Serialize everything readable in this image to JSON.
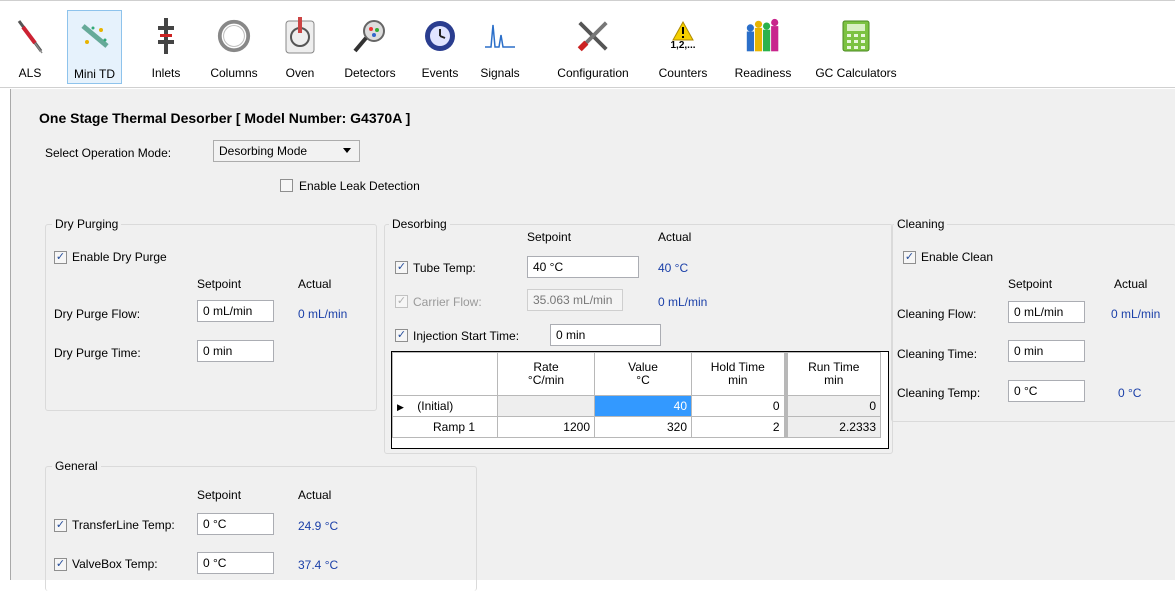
{
  "toolbar": {
    "items": [
      {
        "label": "ALS",
        "icon": "syringe-icon"
      },
      {
        "label": "Mini TD",
        "icon": "mini-td-icon"
      },
      {
        "label": "Inlets",
        "icon": "inlet-icon"
      },
      {
        "label": "Columns",
        "icon": "column-icon"
      },
      {
        "label": "Oven",
        "icon": "oven-icon"
      },
      {
        "label": "Detectors",
        "icon": "detector-icon"
      },
      {
        "label": "Events",
        "icon": "events-icon"
      },
      {
        "label": "Signals",
        "icon": "signal-icon"
      },
      {
        "label": "Configuration",
        "icon": "tools-icon"
      },
      {
        "label": "Counters",
        "icon": "warning-counter-icon",
        "icon_text": "1,2,..."
      },
      {
        "label": "Readiness",
        "icon": "readiness-icon"
      },
      {
        "label": "GC Calculators",
        "icon": "calculator-icon"
      }
    ],
    "active": "Mini TD"
  },
  "page": {
    "title": "One Stage Thermal Desorber [ Model Number: G4370A ]",
    "operation_mode_label": "Select Operation Mode:",
    "operation_mode_value": "Desorbing Mode",
    "leak_detection_label": "Enable Leak Detection",
    "leak_detection_checked": false
  },
  "dry_purging": {
    "title": "Dry Purging",
    "enable_label": "Enable Dry Purge",
    "enable_checked": true,
    "setpoint_header": "Setpoint",
    "actual_header": "Actual",
    "flow_label": "Dry Purge Flow:",
    "flow_setpoint": "0 mL/min",
    "flow_actual": "0 mL/min",
    "time_label": "Dry Purge Time:",
    "time_setpoint": "0 min"
  },
  "desorbing": {
    "title": "Desorbing",
    "setpoint_header": "Setpoint",
    "actual_header": "Actual",
    "tube_temp_label": "Tube Temp:",
    "tube_temp_checked": true,
    "tube_temp_setpoint": "40 °C",
    "tube_temp_actual": "40 °C",
    "carrier_flow_label": "Carrier Flow:",
    "carrier_flow_checked": true,
    "carrier_flow_setpoint": "35.063 mL/min",
    "carrier_flow_actual": "0 mL/min",
    "injection_label": "Injection Start Time:",
    "injection_checked": true,
    "injection_value": "0 min",
    "grid": {
      "headers": [
        {
          "line1": "Rate",
          "line2": "°C/min"
        },
        {
          "line1": "Value",
          "line2": "°C"
        },
        {
          "line1": "Hold Time",
          "line2": "min"
        },
        {
          "line1": "Run Time",
          "line2": "min"
        }
      ],
      "rows": [
        {
          "name": "(Initial)",
          "rate": "",
          "value": "40",
          "hold": "0",
          "run": "0"
        },
        {
          "name": "Ramp 1",
          "rate": "1200",
          "value": "320",
          "hold": "2",
          "run": "2.2333"
        }
      ]
    }
  },
  "cleaning": {
    "title": "Cleaning",
    "enable_label": "Enable Clean",
    "enable_checked": true,
    "setpoint_header": "Setpoint",
    "actual_header": "Actual",
    "flow_label": "Cleaning Flow:",
    "flow_setpoint": "0 mL/min",
    "flow_actual": "0 mL/min",
    "time_label": "Cleaning Time:",
    "time_setpoint": "0 min",
    "temp_label": "Cleaning Temp:",
    "temp_setpoint": "0 °C",
    "temp_actual": "0 °C"
  },
  "general": {
    "title": "General",
    "setpoint_header": "Setpoint",
    "actual_header": "Actual",
    "transfer_label": "TransferLine Temp:",
    "transfer_checked": true,
    "transfer_setpoint": "0 °C",
    "transfer_actual": "24.9 °C",
    "valvebox_label": "ValveBox Temp:",
    "valvebox_checked": true,
    "valvebox_setpoint": "0 °C",
    "valvebox_actual": "37.4 °C"
  },
  "colors": {
    "actual_value": "#1a3fa8",
    "selected_cell": "#3399ff",
    "panel_bg": "#f0f0f0"
  }
}
